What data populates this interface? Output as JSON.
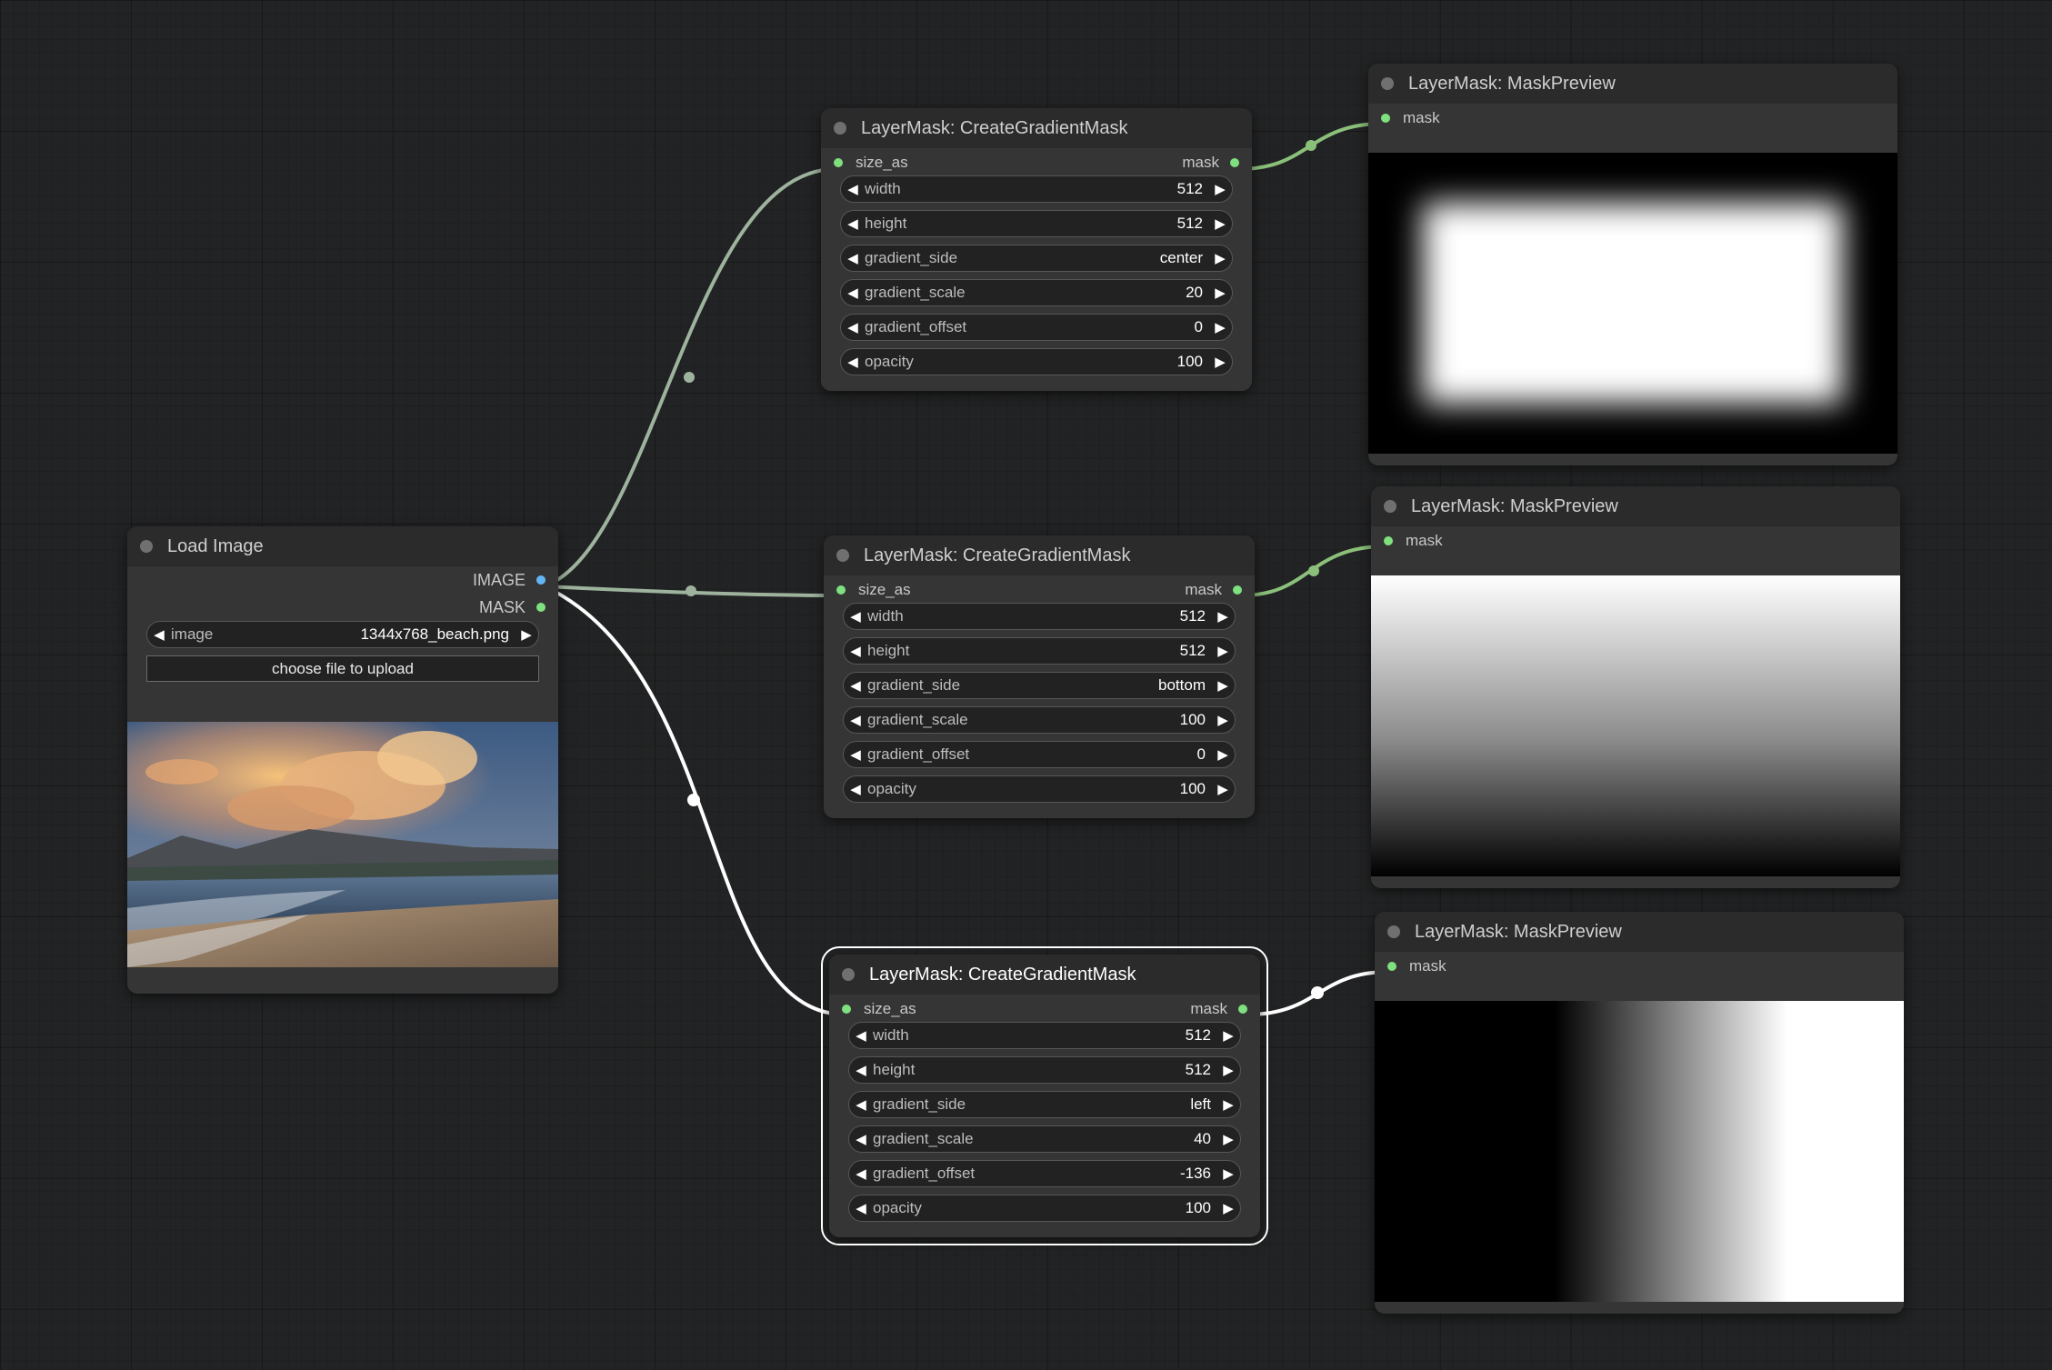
{
  "load_image": {
    "title": "Load Image",
    "outputs": [
      "IMAGE",
      "MASK"
    ],
    "image_widget": {
      "name": "image",
      "value": "1344x768_beach.png"
    },
    "upload_label": "choose file to upload"
  },
  "gradient_nodes": [
    {
      "title": "LayerMask: CreateGradientMask",
      "input": "size_as",
      "output": "mask",
      "widgets": [
        {
          "name": "width",
          "value": "512"
        },
        {
          "name": "height",
          "value": "512"
        },
        {
          "name": "gradient_side",
          "value": "center"
        },
        {
          "name": "gradient_scale",
          "value": "20"
        },
        {
          "name": "gradient_offset",
          "value": "0"
        },
        {
          "name": "opacity",
          "value": "100"
        }
      ]
    },
    {
      "title": "LayerMask: CreateGradientMask",
      "input": "size_as",
      "output": "mask",
      "widgets": [
        {
          "name": "width",
          "value": "512"
        },
        {
          "name": "height",
          "value": "512"
        },
        {
          "name": "gradient_side",
          "value": "bottom"
        },
        {
          "name": "gradient_scale",
          "value": "100"
        },
        {
          "name": "gradient_offset",
          "value": "0"
        },
        {
          "name": "opacity",
          "value": "100"
        }
      ]
    },
    {
      "title": "LayerMask: CreateGradientMask",
      "input": "size_as",
      "output": "mask",
      "widgets": [
        {
          "name": "width",
          "value": "512"
        },
        {
          "name": "height",
          "value": "512"
        },
        {
          "name": "gradient_side",
          "value": "left"
        },
        {
          "name": "gradient_scale",
          "value": "40"
        },
        {
          "name": "gradient_offset",
          "value": "-136"
        },
        {
          "name": "opacity",
          "value": "100"
        }
      ]
    }
  ],
  "preview_nodes": [
    {
      "title": "LayerMask: MaskPreview",
      "input": "mask"
    },
    {
      "title": "LayerMask: MaskPreview",
      "input": "mask"
    },
    {
      "title": "LayerMask: MaskPreview",
      "input": "mask"
    }
  ],
  "colors": {
    "canvas": "#222324",
    "node_body": "#353535",
    "node_title": "#2b2b2b",
    "mask_slot": "#7fe07f",
    "image_slot": "#64b5f6",
    "image_link": "#9eb39e",
    "mask_link": "#8bc07a",
    "selected_link": "#ffffff"
  },
  "icons": {
    "widget_decrement": "left-triangle",
    "widget_increment": "right-triangle",
    "node_status": "grey-dot"
  }
}
